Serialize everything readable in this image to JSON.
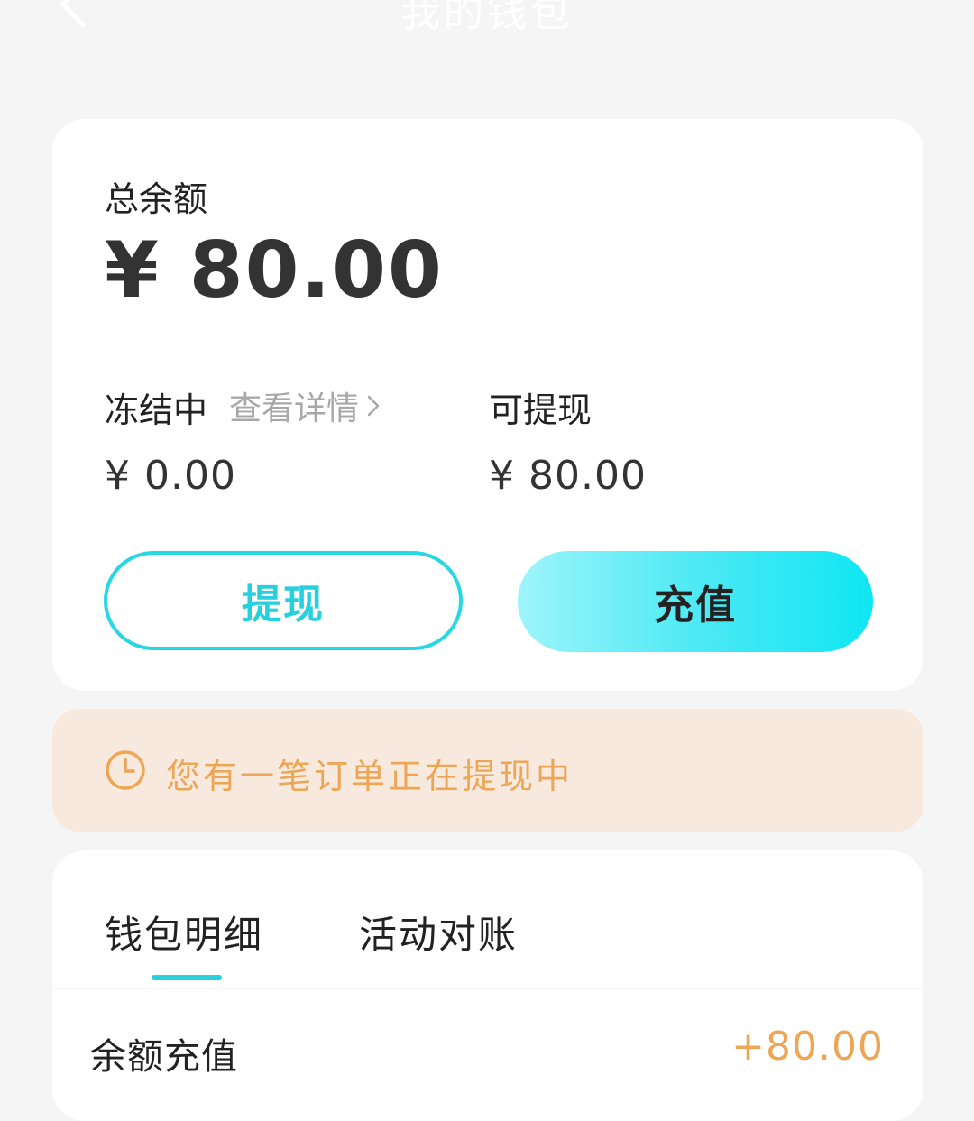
{
  "header": {
    "title": "我的钱包",
    "back_icon": "chevron-left-icon"
  },
  "balance": {
    "total_label": "总余额",
    "total_amount": "¥ 80.00",
    "frozen_label": "冻结中",
    "detail_link": "查看详情",
    "frozen_amount": "¥ 0.00",
    "withdrawable_label": "可提现",
    "withdrawable_amount": "¥ 80.00",
    "withdraw_button": "提现",
    "recharge_button": "充值"
  },
  "notice": {
    "icon": "clock-icon",
    "text": "您有一笔订单正在提现中"
  },
  "tabs": [
    {
      "label": "钱包明细",
      "active": true
    },
    {
      "label": "活动对账",
      "active": false
    }
  ],
  "transactions": [
    {
      "label": "余额充值",
      "amount": "+80.00"
    }
  ],
  "colors": {
    "accent": "#27d0dc",
    "warning_text": "#eda656",
    "warning_bg": "#f8e9de",
    "background": "#f5f5f5"
  }
}
